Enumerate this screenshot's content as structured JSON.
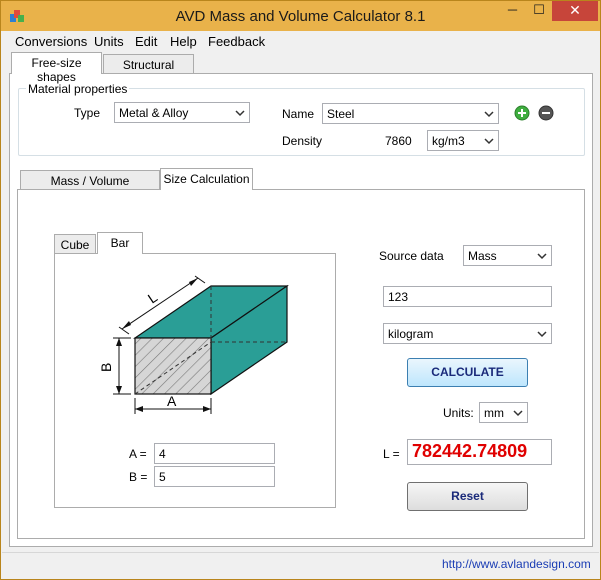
{
  "window": {
    "title": "AVD Mass and Volume Calculator 8.1",
    "minimize_glyph": "─",
    "maximize_glyph": "☐",
    "close_glyph": "✕"
  },
  "menu": [
    "Conversions",
    "Units",
    "Edit",
    "Help",
    "Feedback"
  ],
  "top_tabs": [
    "Free-size shapes",
    "Structural shapes"
  ],
  "material": {
    "group_label": "Material properties",
    "type_label": "Type",
    "type_value": "Metal & Alloy",
    "name_label": "Name",
    "name_value": "Steel",
    "density_label": "Density",
    "density_value": "7860",
    "density_unit": "kg/m3",
    "add_icon": "plus-circle-icon",
    "remove_icon": "minus-circle-icon"
  },
  "calc_tabs": [
    "Mass / Volume  Calculation",
    "Size  Calculation"
  ],
  "shape_tabs": [
    "Cube",
    "Bar"
  ],
  "diagram": {
    "label_l": "L",
    "label_b": "B",
    "label_a": "A"
  },
  "dimensions": {
    "a_label": "A =",
    "a_value": "4",
    "b_label": "B =",
    "b_value": "5"
  },
  "source": {
    "label": "Source data",
    "selected": "Mass",
    "value": "123",
    "unit": "kilogram"
  },
  "calculate_label": "CALCULATE",
  "units": {
    "label": "Units:",
    "value": "mm"
  },
  "result": {
    "label": "L =",
    "value": "782442.74809"
  },
  "reset_label": "Reset",
  "status": {
    "link": "http://www.avlandesign.com"
  },
  "colors": {
    "titlebar": "#e9b24a",
    "close": "#c7453a",
    "teal": "#2a9e96",
    "result_text": "#e00000"
  }
}
